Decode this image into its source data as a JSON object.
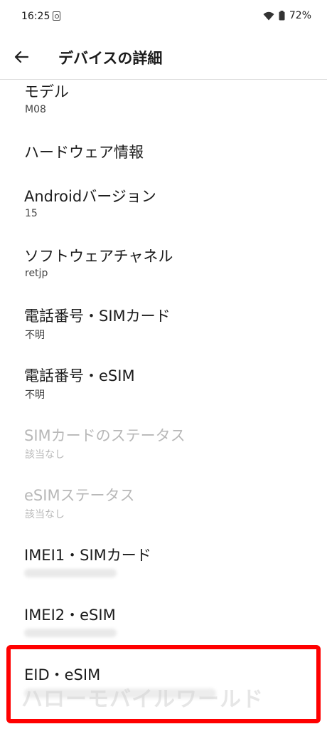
{
  "status_bar": {
    "time": "16:25",
    "battery": "72%"
  },
  "header": {
    "title": "デバイスの詳細"
  },
  "items": [
    {
      "title": "モデル",
      "subtitle": "M08",
      "enabled": true
    },
    {
      "title": "ハードウェア情報",
      "subtitle": "",
      "enabled": true
    },
    {
      "title": "Androidバージョン",
      "subtitle": "15",
      "enabled": true
    },
    {
      "title": "ソフトウェアチャネル",
      "subtitle": "retjp",
      "enabled": true
    },
    {
      "title": "電話番号・SIMカード",
      "subtitle": "不明",
      "enabled": true
    },
    {
      "title": "電話番号・eSIM",
      "subtitle": "不明",
      "enabled": true
    },
    {
      "title": "SIMカードのステータス",
      "subtitle": "該当なし",
      "enabled": false
    },
    {
      "title": "eSIMステータス",
      "subtitle": "該当なし",
      "enabled": false
    },
    {
      "title": "IMEI1・SIMカード",
      "subtitle": "",
      "enabled": true
    },
    {
      "title": "IMEI2・eSIM",
      "subtitle": "",
      "enabled": true
    },
    {
      "title": "EID・eSIM",
      "subtitle": "",
      "enabled": true
    }
  ],
  "watermark": "ハローモバイルワールド",
  "colors": {
    "highlight": "#ff0000",
    "disabled_text": "#b8b8b8",
    "divider": "#dcdcdc"
  },
  "icons": {
    "back": "arrow-left-icon",
    "wifi": "wifi-icon",
    "battery": "battery-icon",
    "status_app": "app-notification-icon"
  }
}
